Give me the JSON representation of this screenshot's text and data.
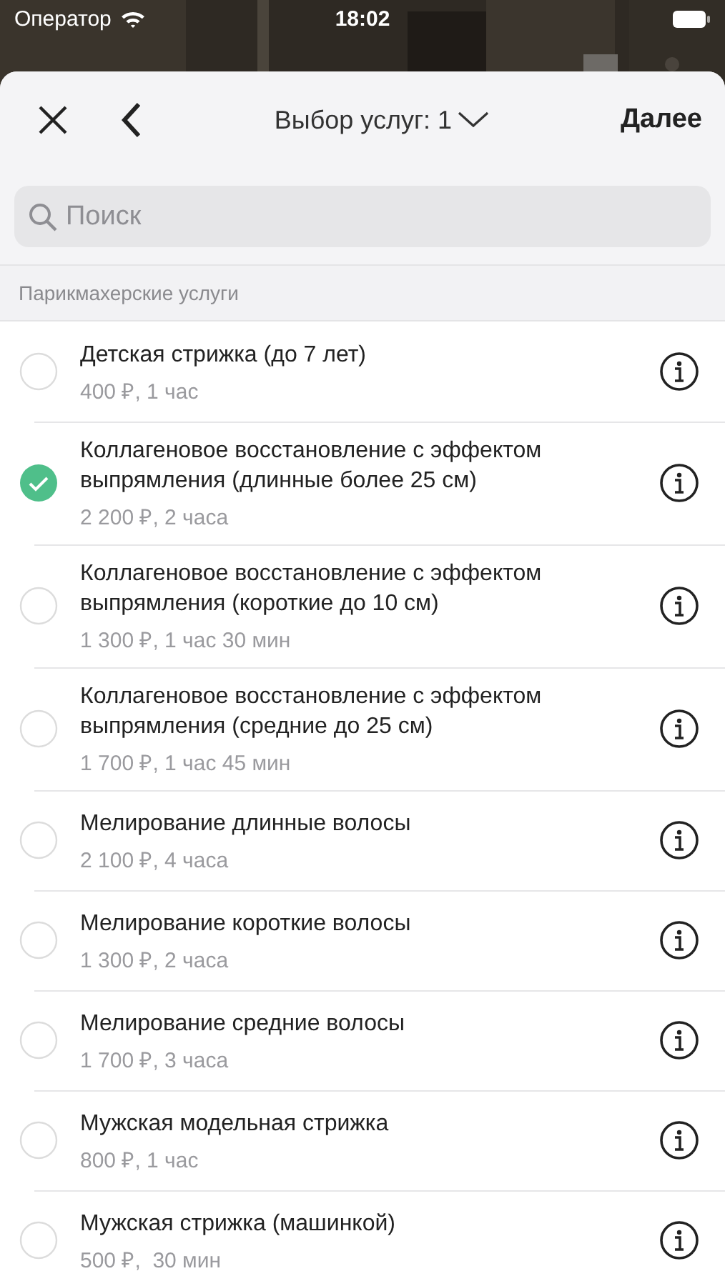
{
  "status_bar": {
    "carrier": "Оператор",
    "time": "18:02"
  },
  "header": {
    "title": "Выбор услуг: 1",
    "next": "Далее"
  },
  "search": {
    "placeholder": "Поиск"
  },
  "section": {
    "title": "Парикмахерские услуги"
  },
  "services": [
    {
      "name": "Детская стрижка (до 7 лет)",
      "details": "400 ₽, 1 час",
      "selected": false
    },
    {
      "name": "Коллагеновое восстановление с эффектом выпрямления (длинные более 25 см)",
      "details": "2 200 ₽, 2 часа",
      "selected": true
    },
    {
      "name": "Коллагеновое восстановление с эффектом выпрямления (короткие до 10 см)",
      "details": "1 300 ₽, 1 час 30 мин",
      "selected": false
    },
    {
      "name": "Коллагеновое восстановление с эффектом выпрямления (средние до 25 см)",
      "details": "1 700 ₽, 1 час 45 мин",
      "selected": false
    },
    {
      "name": "Мелирование длинные волосы",
      "details": "2 100 ₽, 4 часа",
      "selected": false
    },
    {
      "name": "Мелирование короткие волосы",
      "details": "1 300 ₽, 2 часа",
      "selected": false
    },
    {
      "name": "Мелирование средние волосы",
      "details": "1 700 ₽, 3 часа",
      "selected": false
    },
    {
      "name": "Мужская модельная стрижка",
      "details": "800 ₽, 1 час",
      "selected": false
    },
    {
      "name": "Мужская стрижка (машинкой)",
      "details": "500 ₽,  30 мин",
      "selected": false
    }
  ]
}
